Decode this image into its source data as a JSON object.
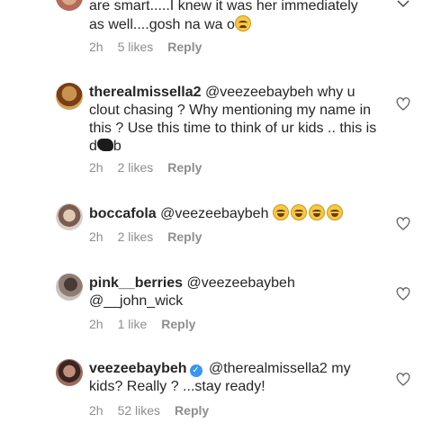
{
  "comments": [
    {
      "line1": "are smart.....I knew it was her immediately",
      "line2": "as well....gosh na wa o",
      "time": "2h",
      "likes": "5 likes",
      "reply": "Reply"
    },
    {
      "username": "therealmissella2",
      "text_a": "@veezeebaybeh why u clout chasing ? Why mentioning my name in this ? Use this time to think of ur kids .. this is d",
      "text_b": "b",
      "time": "2h",
      "likes": "2 likes",
      "reply": "Reply"
    },
    {
      "username": "boccafola",
      "mention": "@veezeebaybeh",
      "time": "2h",
      "likes": "2 likes",
      "reply": "Reply"
    },
    {
      "username": "pink__berries",
      "text": "@veezeebaybeh @__john_wick",
      "time": "2h",
      "likes": "1 like",
      "reply": "Reply"
    },
    {
      "username": "veezeebaybeh",
      "text": "@therealmissella2 my kids? Really ? ...stay ready!",
      "time": "2h",
      "likes": "52 likes",
      "reply": "Reply"
    }
  ],
  "icons": {
    "heart": "heart-outline-icon",
    "verified": "verified-badge-icon",
    "emoji": "laughing-face-emoji"
  }
}
